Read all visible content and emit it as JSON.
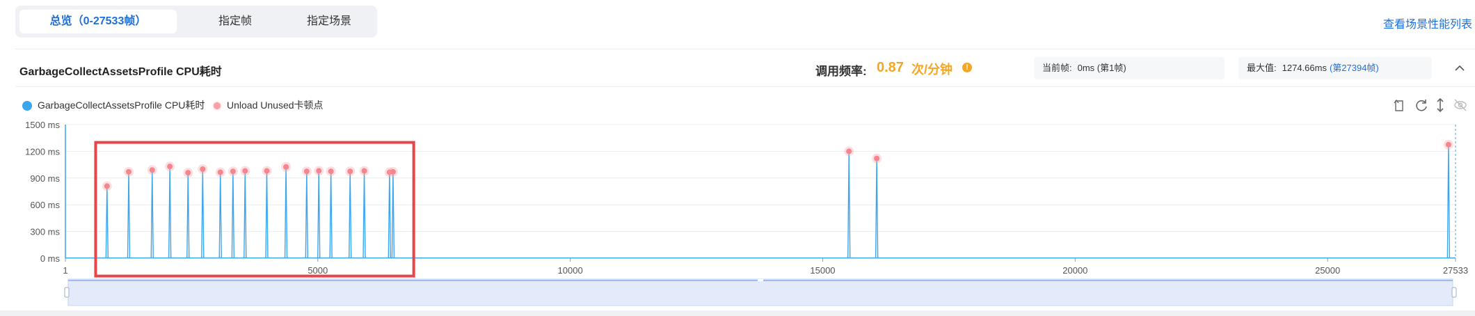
{
  "tabs": [
    {
      "label": "总览（0-27533帧）",
      "active": true
    },
    {
      "label": "指定帧",
      "active": false
    },
    {
      "label": "指定场景",
      "active": false
    }
  ],
  "scene_link": "查看场景性能列表",
  "section": {
    "title": "GarbageCollectAssetsProfile CPU耗时",
    "freq_label": "调用频率:",
    "freq_value": "0.87",
    "freq_unit": "次/分钟",
    "current_frame_label": "当前帧:",
    "current_frame_value": "0ms (第1帧)",
    "max_label": "最大值:",
    "max_value": "1274.66ms",
    "max_frame": "(第27394帧)"
  },
  "legend": [
    {
      "label": "GarbageCollectAssetsProfile CPU耗时",
      "color": "#3ba6ef"
    },
    {
      "label": "Unload Unused卡顿点",
      "color": "#f8a2a8"
    }
  ],
  "icons": [
    "back-icon",
    "refresh-icon",
    "vertical-resize-icon",
    "hide-icon",
    "help-icon",
    "collapse-icon"
  ],
  "highlight_color": "#e8454a",
  "chart_data": {
    "type": "line",
    "xlim": [
      1,
      27533
    ],
    "ylim": [
      0,
      1500
    ],
    "x_ticks": [
      1,
      5000,
      10000,
      15000,
      20000,
      25000,
      27533
    ],
    "y_ticks": [
      0,
      300,
      600,
      900,
      1200,
      1500
    ],
    "y_tick_labels": [
      "0 ms",
      "300 ms",
      "600 ms",
      "900 ms",
      "1200 ms",
      "1500 ms"
    ],
    "series": [
      {
        "name": "GarbageCollectAssetsProfile CPU耗时",
        "color": "#3ba6ef",
        "spikes": [
          {
            "x": 825,
            "y": 810
          },
          {
            "x": 1255,
            "y": 970
          },
          {
            "x": 1720,
            "y": 990
          },
          {
            "x": 2070,
            "y": 1030
          },
          {
            "x": 2430,
            "y": 960
          },
          {
            "x": 2720,
            "y": 1000
          },
          {
            "x": 3070,
            "y": 965
          },
          {
            "x": 3320,
            "y": 975
          },
          {
            "x": 3560,
            "y": 980
          },
          {
            "x": 3990,
            "y": 980
          },
          {
            "x": 4370,
            "y": 1025
          },
          {
            "x": 4780,
            "y": 975
          },
          {
            "x": 5020,
            "y": 980
          },
          {
            "x": 5260,
            "y": 975
          },
          {
            "x": 5640,
            "y": 975
          },
          {
            "x": 5920,
            "y": 980
          },
          {
            "x": 6420,
            "y": 965
          },
          {
            "x": 6490,
            "y": 970
          },
          {
            "x": 15520,
            "y": 1200
          },
          {
            "x": 16070,
            "y": 1120
          },
          {
            "x": 27394,
            "y": 1274.66
          }
        ]
      },
      {
        "name": "Unload Unused卡顿点",
        "color": "#f8a2a8",
        "type": "scatter",
        "points": [
          {
            "x": 825,
            "y": 810
          },
          {
            "x": 1255,
            "y": 970
          },
          {
            "x": 1720,
            "y": 990
          },
          {
            "x": 2070,
            "y": 1030
          },
          {
            "x": 2430,
            "y": 960
          },
          {
            "x": 2720,
            "y": 1000
          },
          {
            "x": 3070,
            "y": 965
          },
          {
            "x": 3320,
            "y": 975
          },
          {
            "x": 3560,
            "y": 980
          },
          {
            "x": 3990,
            "y": 980
          },
          {
            "x": 4370,
            "y": 1025
          },
          {
            "x": 4780,
            "y": 975
          },
          {
            "x": 5020,
            "y": 980
          },
          {
            "x": 5260,
            "y": 975
          },
          {
            "x": 5640,
            "y": 975
          },
          {
            "x": 5920,
            "y": 980
          },
          {
            "x": 6420,
            "y": 965
          },
          {
            "x": 6490,
            "y": 970
          },
          {
            "x": 15520,
            "y": 1200
          },
          {
            "x": 16070,
            "y": 1120
          },
          {
            "x": 27394,
            "y": 1274.66
          }
        ]
      }
    ],
    "highlight_range": {
      "x": [
        600,
        6900
      ],
      "y": [
        -200,
        1300
      ]
    },
    "grid": true,
    "legend_position": "top-left",
    "data_zoom": [
      1,
      27533
    ]
  }
}
